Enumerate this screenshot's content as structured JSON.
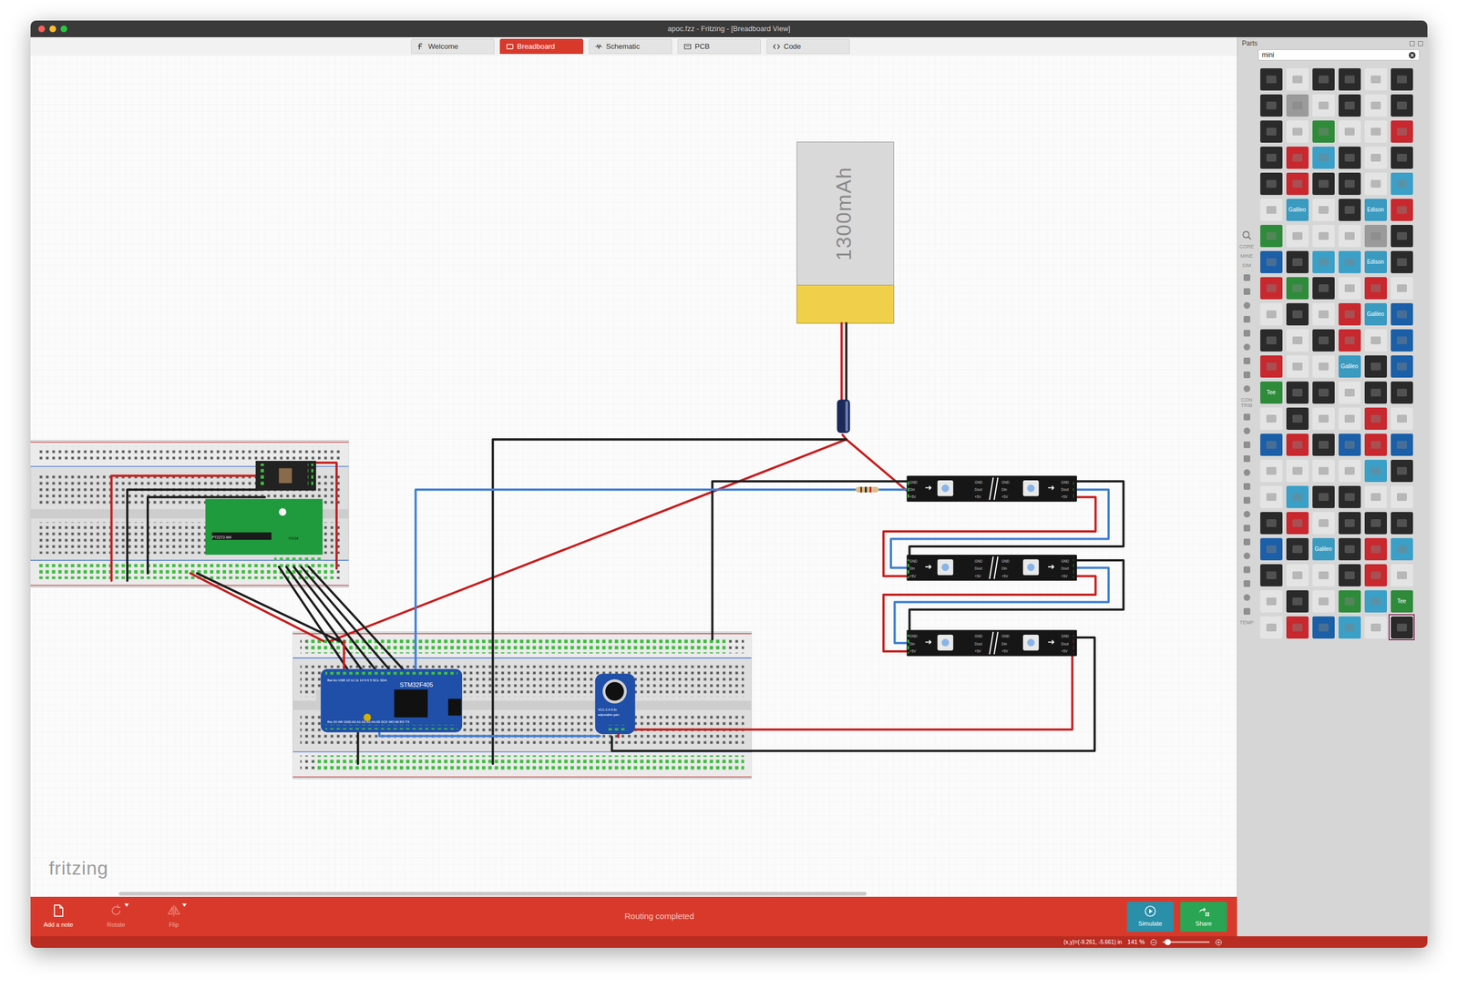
{
  "window": {
    "title": "apoc.fzz - Fritzing - [Breadboard View]"
  },
  "tabs": [
    {
      "label": "Welcome",
      "selected": false
    },
    {
      "label": "Breadboard",
      "selected": true
    },
    {
      "label": "Schematic",
      "selected": false
    },
    {
      "label": "PCB",
      "selected": false
    },
    {
      "label": "Code",
      "selected": false
    }
  ],
  "diagram": {
    "battery": {
      "label": "1300mAh"
    },
    "mcu": {
      "label": "STM32F405",
      "pins_top": "Bat En USB 13 12 11 10 9 6 5 SCL SDA",
      "pins_bottom": "Rst 3V AR GND A0 A1 A2 A3 A4 A5 SCK MO MI RX TX"
    },
    "receiver": {
      "labels": [
        "PT2272-M4",
        "YK04"
      ]
    },
    "mic": {
      "labels": [
        "VCC 2.4-5.5v",
        "adjustable gain"
      ]
    },
    "strips": [
      {
        "segments": [
          {
            "pins": [
              "GND",
              "Din",
              "+5V"
            ]
          },
          {
            "pins": [
              "GND",
              "Dout",
              "+5V"
            ]
          },
          {
            "pins": [
              "GND",
              "Din",
              "+5V"
            ]
          },
          {
            "pins": [
              "GND",
              "Dout",
              "+5V"
            ]
          }
        ]
      },
      {
        "segments": [
          {
            "pins": [
              "GND",
              "Din",
              "+5V"
            ]
          },
          {
            "pins": [
              "GND",
              "Dout",
              "+5V"
            ]
          },
          {
            "pins": [
              "GND",
              "Din",
              "+5V"
            ]
          },
          {
            "pins": [
              "GND",
              "Dout",
              "+5V"
            ]
          }
        ]
      },
      {
        "segments": [
          {
            "pins": [
              "GND",
              "Din",
              "+5V"
            ]
          },
          {
            "pins": [
              "GND",
              "Dout",
              "+5V"
            ]
          },
          {
            "pins": [
              "GND",
              "Din",
              "+5V"
            ]
          },
          {
            "pins": [
              "GND",
              "Dout",
              "+5V"
            ]
          }
        ]
      }
    ]
  },
  "watermark": "fritzing",
  "toolbar": {
    "buttons": [
      {
        "label": "Add a note",
        "disabled": false
      },
      {
        "label": "Rotate",
        "disabled": true
      },
      {
        "label": "Flip",
        "disabled": true
      }
    ],
    "message": "Routing completed",
    "simulate": "Simulate",
    "share": "Share"
  },
  "status_bar": {
    "coords": "(x,y)=(-9.261, -5.661) in",
    "zoom": "141 %",
    "zoom_level": 0.05
  },
  "parts_panel": {
    "title": "Parts",
    "search": "mini",
    "bins": [
      {
        "kind": "icon"
      },
      {
        "kind": "label",
        "label": "CORE"
      },
      {
        "kind": "label",
        "label": "MINE"
      },
      {
        "kind": "label",
        "label": "SIM"
      },
      {
        "kind": "icon"
      },
      {
        "kind": "icon"
      },
      {
        "kind": "icon"
      },
      {
        "kind": "icon"
      },
      {
        "kind": "icon"
      },
      {
        "kind": "icon"
      },
      {
        "kind": "icon"
      },
      {
        "kind": "icon"
      },
      {
        "kind": "icon"
      },
      {
        "kind": "label",
        "label": "CON TRIB"
      },
      {
        "kind": "icon"
      },
      {
        "kind": "icon"
      },
      {
        "kind": "icon"
      },
      {
        "kind": "icon"
      },
      {
        "kind": "icon"
      },
      {
        "kind": "icon"
      },
      {
        "kind": "icon"
      },
      {
        "kind": "icon"
      },
      {
        "kind": "icon"
      },
      {
        "kind": "icon"
      },
      {
        "kind": "icon"
      },
      {
        "kind": "icon"
      },
      {
        "kind": "icon"
      },
      {
        "kind": "icon"
      },
      {
        "kind": "icon"
      },
      {
        "kind": "label",
        "label": "TEMP"
      }
    ],
    "parts": [
      {
        "color": "#2a2a2a",
        "selected": false
      },
      {
        "color": "#e4e4e4",
        "selected": false
      },
      {
        "color": "#2a2a2a",
        "selected": false
      },
      {
        "color": "#2a2a2a",
        "selected": false
      },
      {
        "color": "#e4e4e4",
        "selected": false
      },
      {
        "color": "#2a2a2a",
        "selected": false
      },
      {
        "color": "#2a2a2a",
        "selected": false
      },
      {
        "color": "#9a9a9a",
        "selected": false
      },
      {
        "color": "#e4e4e4",
        "selected": false
      },
      {
        "color": "#2a2a2a",
        "selected": false
      },
      {
        "color": "#e4e4e4",
        "selected": false
      },
      {
        "color": "#2a2a2a",
        "selected": false
      },
      {
        "color": "#2a2a2a",
        "selected": false
      },
      {
        "color": "#e4e4e4",
        "selected": false
      },
      {
        "color": "#2e8b3a",
        "selected": false
      },
      {
        "color": "#e4e4e4",
        "selected": false
      },
      {
        "color": "#e4e4e4",
        "selected": false
      },
      {
        "color": "#c8282e",
        "selected": false
      },
      {
        "color": "#2a2a2a",
        "selected": false
      },
      {
        "color": "#c8282e",
        "selected": false
      },
      {
        "color": "#3aa0c8",
        "selected": false
      },
      {
        "color": "#2a2a2a",
        "selected": false
      },
      {
        "color": "#e4e4e4",
        "selected": false
      },
      {
        "color": "#2a2a2a",
        "selected": false
      },
      {
        "color": "#2a2a2a",
        "selected": false
      },
      {
        "color": "#c8282e",
        "selected": false
      },
      {
        "color": "#2a2a2a",
        "selected": false
      },
      {
        "color": "#2a2a2a",
        "selected": false
      },
      {
        "color": "#e4e4e4",
        "selected": false
      },
      {
        "color": "#3aa0c8",
        "selected": false
      },
      {
        "color": "#e4e4e4",
        "selected": false
      },
      {
        "color": "#3a9ac0",
        "label": "Galileo",
        "selected": false
      },
      {
        "color": "#e4e4e4",
        "selected": false
      },
      {
        "color": "#2a2a2a",
        "selected": false
      },
      {
        "color": "#3a9ac0",
        "label": "Edison",
        "selected": false
      },
      {
        "color": "#c8282e",
        "selected": false
      },
      {
        "color": "#2e8b3a",
        "selected": false
      },
      {
        "color": "#e4e4e4",
        "selected": false
      },
      {
        "color": "#e4e4e4",
        "selected": false
      },
      {
        "color": "#e4e4e4",
        "selected": false
      },
      {
        "color": "#9a9a9a",
        "selected": false
      },
      {
        "color": "#2a2a2a",
        "selected": false
      },
      {
        "color": "#1b5fa8",
        "selected": false
      },
      {
        "color": "#2a2a2a",
        "selected": false
      },
      {
        "color": "#3aa0c8",
        "selected": false
      },
      {
        "color": "#3aa0c8",
        "selected": false
      },
      {
        "color": "#3a9ac0",
        "label": "Edison",
        "selected": false
      },
      {
        "color": "#2a2a2a",
        "selected": false
      },
      {
        "color": "#c8282e",
        "selected": false
      },
      {
        "color": "#2e8b3a",
        "selected": false
      },
      {
        "color": "#2a2a2a",
        "selected": false
      },
      {
        "color": "#e4e4e4",
        "selected": false
      },
      {
        "color": "#c8282e",
        "selected": false
      },
      {
        "color": "#e4e4e4",
        "selected": false
      },
      {
        "color": "#e4e4e4",
        "selected": false
      },
      {
        "color": "#2a2a2a",
        "selected": false
      },
      {
        "color": "#e4e4e4",
        "selected": false
      },
      {
        "color": "#c8282e",
        "selected": false
      },
      {
        "color": "#3a9ac0",
        "label": "Galileo",
        "selected": false
      },
      {
        "color": "#1b5fa8",
        "selected": false
      },
      {
        "color": "#2a2a2a",
        "selected": false
      },
      {
        "color": "#e4e4e4",
        "selected": false
      },
      {
        "color": "#2a2a2a",
        "selected": false
      },
      {
        "color": "#c8282e",
        "selected": false
      },
      {
        "color": "#e4e4e4",
        "selected": false
      },
      {
        "color": "#1b5fa8",
        "selected": false
      },
      {
        "color": "#c8282e",
        "selected": false
      },
      {
        "color": "#e4e4e4",
        "selected": false
      },
      {
        "color": "#e4e4e4",
        "selected": false
      },
      {
        "color": "#3a9ac0",
        "label": "Galileo",
        "selected": false
      },
      {
        "color": "#2a2a2a",
        "selected": false
      },
      {
        "color": "#1b5fa8",
        "selected": false
      },
      {
        "color": "#2e8b3a",
        "label": "Tee",
        "selected": false
      },
      {
        "color": "#2a2a2a",
        "selected": false
      },
      {
        "color": "#2a2a2a",
        "selected": false
      },
      {
        "color": "#e4e4e4",
        "selected": false
      },
      {
        "color": "#2a2a2a",
        "selected": false
      },
      {
        "color": "#2a2a2a",
        "selected": false
      },
      {
        "color": "#e4e4e4",
        "selected": false
      },
      {
        "color": "#2a2a2a",
        "selected": false
      },
      {
        "color": "#e4e4e4",
        "selected": false
      },
      {
        "color": "#e4e4e4",
        "selected": false
      },
      {
        "color": "#c8282e",
        "selected": false
      },
      {
        "color": "#e4e4e4",
        "selected": false
      },
      {
        "color": "#1b5fa8",
        "selected": false
      },
      {
        "color": "#c8282e",
        "selected": false
      },
      {
        "color": "#2a2a2a",
        "selected": false
      },
      {
        "color": "#1b5fa8",
        "selected": false
      },
      {
        "color": "#c8282e",
        "selected": false
      },
      {
        "color": "#1b5fa8",
        "selected": false
      },
      {
        "color": "#e4e4e4",
        "selected": false
      },
      {
        "color": "#e4e4e4",
        "selected": false
      },
      {
        "color": "#e4e4e4",
        "selected": false
      },
      {
        "color": "#e4e4e4",
        "selected": false
      },
      {
        "color": "#3aa0c8",
        "selected": false
      },
      {
        "color": "#2a2a2a",
        "selected": false
      },
      {
        "color": "#e4e4e4",
        "selected": false
      },
      {
        "color": "#3aa0c8",
        "selected": false
      },
      {
        "color": "#2a2a2a",
        "selected": false
      },
      {
        "color": "#2a2a2a",
        "selected": false
      },
      {
        "color": "#e4e4e4",
        "selected": false
      },
      {
        "color": "#e4e4e4",
        "selected": false
      },
      {
        "color": "#2a2a2a",
        "selected": false
      },
      {
        "color": "#c8282e",
        "selected": false
      },
      {
        "color": "#e4e4e4",
        "selected": false
      },
      {
        "color": "#2a2a2a",
        "selected": false
      },
      {
        "color": "#2a2a2a",
        "selected": false
      },
      {
        "color": "#2a2a2a",
        "selected": false
      },
      {
        "color": "#1b5fa8",
        "selected": false
      },
      {
        "color": "#2a2a2a",
        "selected": false
      },
      {
        "color": "#3a9ac0",
        "label": "Galileo",
        "selected": false
      },
      {
        "color": "#2a2a2a",
        "selected": false
      },
      {
        "color": "#c8282e",
        "selected": false
      },
      {
        "color": "#3aa0c8",
        "selected": false
      },
      {
        "color": "#2a2a2a",
        "selected": false
      },
      {
        "color": "#e4e4e4",
        "selected": false
      },
      {
        "color": "#e4e4e4",
        "selected": false
      },
      {
        "color": "#2a2a2a",
        "selected": false
      },
      {
        "color": "#c8282e",
        "selected": false
      },
      {
        "color": "#e4e4e4",
        "selected": false
      },
      {
        "color": "#e4e4e4",
        "selected": false
      },
      {
        "color": "#2a2a2a",
        "selected": false
      },
      {
        "color": "#e4e4e4",
        "selected": false
      },
      {
        "color": "#2e8b3a",
        "selected": false
      },
      {
        "color": "#3aa0c8",
        "selected": false
      },
      {
        "color": "#2e8b3a",
        "label": "Tee",
        "selected": false
      },
      {
        "color": "#e4e4e4",
        "selected": false
      },
      {
        "color": "#c8282e",
        "selected": false
      },
      {
        "color": "#1b5fa8",
        "selected": false
      },
      {
        "color": "#3aa0c8",
        "selected": false
      },
      {
        "color": "#e4e4e4",
        "selected": false
      },
      {
        "color": "#2a2a2a",
        "selected": true
      }
    ]
  }
}
